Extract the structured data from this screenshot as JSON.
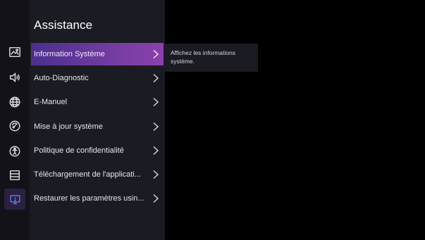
{
  "panel": {
    "title": "Assistance"
  },
  "rail": {
    "icons": [
      {
        "name": "picture-icon"
      },
      {
        "name": "sound-icon"
      },
      {
        "name": "network-globe-icon"
      },
      {
        "name": "system-dial-icon"
      },
      {
        "name": "accessibility-icon"
      },
      {
        "name": "apps-list-icon"
      },
      {
        "name": "support-screen-icon",
        "active": true
      }
    ]
  },
  "menu": {
    "items": [
      {
        "label": "Information Système",
        "selected": true
      },
      {
        "label": "Auto-Diagnostic"
      },
      {
        "label": "E-Manuel"
      },
      {
        "label": "Mise à jour système"
      },
      {
        "label": "Politique de confidentialité"
      },
      {
        "label": "Téléchargement de l'applicati..."
      },
      {
        "label": "Restaurer les paramètres usin..."
      }
    ]
  },
  "description": {
    "text": "Affichez les informations système."
  },
  "colors": {
    "background": "#000000",
    "rail": "#121218",
    "panel": "#1b1b23",
    "accent_start": "#4a2f8e",
    "accent_end": "#8c40ac",
    "active_icon": "#6e7cf0"
  }
}
